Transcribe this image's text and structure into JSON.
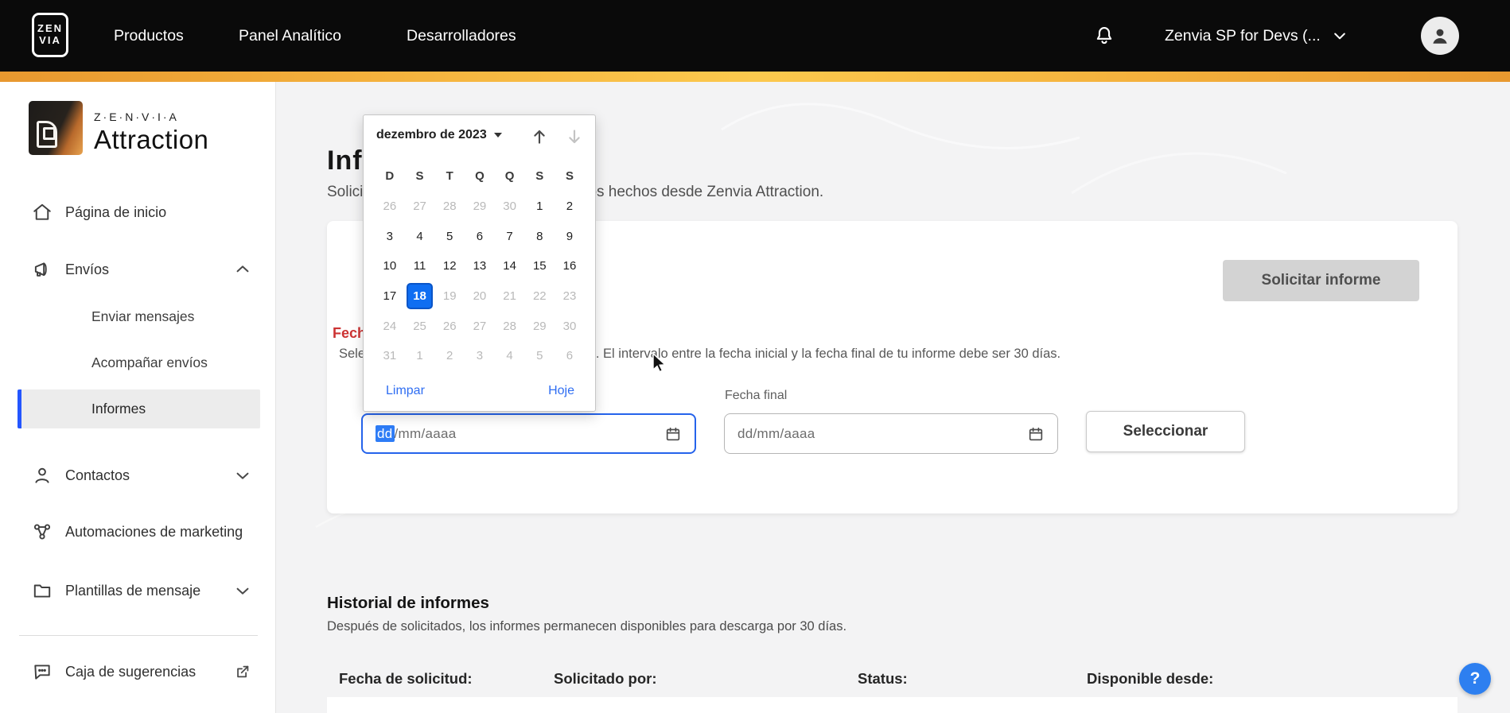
{
  "colors": {
    "topbar_bg": "#0a0a0a",
    "brand_bar_gradient": [
      "#e8982f",
      "#fcc94e",
      "#e8982f"
    ],
    "accent_blue": "#2563eb",
    "selection_blue": "#2e7cf6",
    "calendar_selected_blue": "#0f6ef2",
    "link_blue": "#2f6ef2",
    "active_item_bar": "#2456ff",
    "section_label_red": "#cc3333",
    "help_button_bg": "#2d7ff0",
    "page_bg": "#f3f3f4"
  },
  "topnav": {
    "logo": {
      "line1": "ZEN",
      "line2": "VIA"
    },
    "items": [
      "Productos",
      "Panel Analítico",
      "Desarrolladores"
    ],
    "account_label": "Zenvia SP for Devs (..."
  },
  "sidebar": {
    "brand_wordmark": "Z·E·N·V·I·A",
    "brand_product": "Attraction",
    "items": {
      "home": "Página de inicio",
      "envios": "Envíos",
      "enviar_mensajes": "Enviar mensajes",
      "acompanar_envios": "Acompañar envíos",
      "informes": "Informes",
      "contactos": "Contactos",
      "automaciones": "Automaciones de marketing",
      "plantillas": "Plantillas de mensaje",
      "sugerencias": "Caja de sugerencias"
    }
  },
  "page": {
    "title": "Informes de envío",
    "subtitle": "Solicita informes detallados de los envíos hechos desde Zenvia Attraction."
  },
  "request_card": {
    "section_label": "Fechas de los envíos",
    "info_text": "Selecciona las fechas del período de envíos. El intervalo entre la fecha inicial y la fecha final de tu informe debe ser 30 días.",
    "request_button": "Solicitar informe",
    "fecha_final_label": "Fecha final",
    "start_date_selected_segment": "dd",
    "start_date_rest": "/mm/aaaa",
    "end_date_placeholder": "dd/mm/aaaa",
    "select_button": "Seleccionar"
  },
  "calendar": {
    "month_label": "dezembro de 2023",
    "day_headers": [
      "D",
      "S",
      "T",
      "Q",
      "Q",
      "S",
      "S"
    ],
    "weeks": [
      [
        {
          "n": "26",
          "s": "muted"
        },
        {
          "n": "27",
          "s": "muted"
        },
        {
          "n": "28",
          "s": "muted"
        },
        {
          "n": "29",
          "s": "muted"
        },
        {
          "n": "30",
          "s": "muted"
        },
        {
          "n": "1",
          "s": "normal"
        },
        {
          "n": "2",
          "s": "normal"
        }
      ],
      [
        {
          "n": "3",
          "s": "normal"
        },
        {
          "n": "4",
          "s": "normal"
        },
        {
          "n": "5",
          "s": "normal"
        },
        {
          "n": "6",
          "s": "normal"
        },
        {
          "n": "7",
          "s": "normal"
        },
        {
          "n": "8",
          "s": "normal"
        },
        {
          "n": "9",
          "s": "normal"
        }
      ],
      [
        {
          "n": "10",
          "s": "normal"
        },
        {
          "n": "11",
          "s": "normal"
        },
        {
          "n": "12",
          "s": "normal"
        },
        {
          "n": "13",
          "s": "normal"
        },
        {
          "n": "14",
          "s": "normal"
        },
        {
          "n": "15",
          "s": "normal"
        },
        {
          "n": "16",
          "s": "normal"
        }
      ],
      [
        {
          "n": "17",
          "s": "normal"
        },
        {
          "n": "18",
          "s": "selected"
        },
        {
          "n": "19",
          "s": "muted"
        },
        {
          "n": "20",
          "s": "muted"
        },
        {
          "n": "21",
          "s": "muted"
        },
        {
          "n": "22",
          "s": "muted"
        },
        {
          "n": "23",
          "s": "muted"
        }
      ],
      [
        {
          "n": "24",
          "s": "muted"
        },
        {
          "n": "25",
          "s": "muted"
        },
        {
          "n": "26",
          "s": "muted"
        },
        {
          "n": "27",
          "s": "muted"
        },
        {
          "n": "28",
          "s": "muted"
        },
        {
          "n": "29",
          "s": "muted"
        },
        {
          "n": "30",
          "s": "muted"
        }
      ],
      [
        {
          "n": "31",
          "s": "muted"
        },
        {
          "n": "1",
          "s": "muted"
        },
        {
          "n": "2",
          "s": "muted"
        },
        {
          "n": "3",
          "s": "muted"
        },
        {
          "n": "4",
          "s": "muted"
        },
        {
          "n": "5",
          "s": "muted"
        },
        {
          "n": "6",
          "s": "muted"
        }
      ]
    ],
    "selected_day": "18",
    "clear_label": "Limpar",
    "today_label": "Hoje"
  },
  "history": {
    "title": "Historial de informes",
    "subtitle": "Después de solicitados, los informes permanecen disponibles para descarga por 30 días.",
    "columns": [
      "Fecha de solicitud:",
      "Solicitado por:",
      "Status:",
      "Disponible desde:"
    ],
    "column_lefts": [
      426,
      696,
      1078,
      1366
    ]
  },
  "help": {
    "label": "?"
  }
}
